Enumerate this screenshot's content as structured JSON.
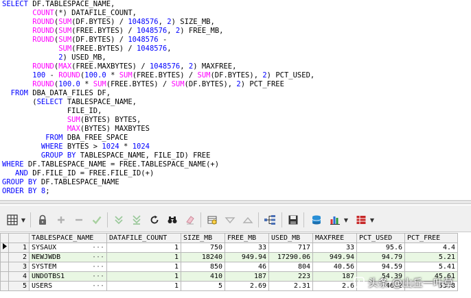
{
  "sql_editor": {
    "lines": [
      [
        [
          "kw",
          "SELECT"
        ],
        [
          "op",
          " DF.TABLESPACE_NAME,"
        ]
      ],
      [
        [
          "op",
          "       "
        ],
        [
          "fn",
          "COUNT"
        ],
        [
          "op",
          "(*) DATAFILE_COUNT,"
        ]
      ],
      [
        [
          "op",
          "       "
        ],
        [
          "fn",
          "ROUND"
        ],
        [
          "op",
          "("
        ],
        [
          "fn",
          "SUM"
        ],
        [
          "op",
          "(DF.BYTES) / "
        ],
        [
          "num",
          "1048576"
        ],
        [
          "op",
          ", "
        ],
        [
          "num",
          "2"
        ],
        [
          "op",
          ") SIZE_MB,"
        ]
      ],
      [
        [
          "op",
          "       "
        ],
        [
          "fn",
          "ROUND"
        ],
        [
          "op",
          "("
        ],
        [
          "fn",
          "SUM"
        ],
        [
          "op",
          "(FREE.BYTES) / "
        ],
        [
          "num",
          "1048576"
        ],
        [
          "op",
          ", "
        ],
        [
          "num",
          "2"
        ],
        [
          "op",
          ") FREE_MB,"
        ]
      ],
      [
        [
          "op",
          "       "
        ],
        [
          "fn",
          "ROUND"
        ],
        [
          "op",
          "("
        ],
        [
          "fn",
          "SUM"
        ],
        [
          "op",
          "(DF.BYTES) / "
        ],
        [
          "num",
          "1048576"
        ],
        [
          "op",
          " -"
        ]
      ],
      [
        [
          "op",
          "             "
        ],
        [
          "fn",
          "SUM"
        ],
        [
          "op",
          "(FREE.BYTES) / "
        ],
        [
          "num",
          "1048576"
        ],
        [
          "op",
          ","
        ]
      ],
      [
        [
          "op",
          "             "
        ],
        [
          "num",
          "2"
        ],
        [
          "op",
          ") USED_MB,"
        ]
      ],
      [
        [
          "op",
          "       "
        ],
        [
          "fn",
          "ROUND"
        ],
        [
          "op",
          "("
        ],
        [
          "fn",
          "MAX"
        ],
        [
          "op",
          "(FREE.MAXBYTES) / "
        ],
        [
          "num",
          "1048576"
        ],
        [
          "op",
          ", "
        ],
        [
          "num",
          "2"
        ],
        [
          "op",
          ") MAXFREE,"
        ]
      ],
      [
        [
          "op",
          "       "
        ],
        [
          "num",
          "100"
        ],
        [
          "op",
          " - "
        ],
        [
          "fn",
          "ROUND"
        ],
        [
          "op",
          "("
        ],
        [
          "num",
          "100.0"
        ],
        [
          "op",
          " * "
        ],
        [
          "fn",
          "SUM"
        ],
        [
          "op",
          "(FREE.BYTES) / "
        ],
        [
          "fn",
          "SUM"
        ],
        [
          "op",
          "(DF.BYTES), "
        ],
        [
          "num",
          "2"
        ],
        [
          "op",
          ") PCT_USED,"
        ]
      ],
      [
        [
          "op",
          "       "
        ],
        [
          "fn",
          "ROUND"
        ],
        [
          "op",
          "("
        ],
        [
          "num",
          "100.0"
        ],
        [
          "op",
          " * "
        ],
        [
          "fn",
          "SUM"
        ],
        [
          "op",
          "(FREE.BYTES) / "
        ],
        [
          "fn",
          "SUM"
        ],
        [
          "op",
          "(DF.BYTES), "
        ],
        [
          "num",
          "2"
        ],
        [
          "op",
          ") PCT_FREE"
        ]
      ],
      [
        [
          "op",
          "  "
        ],
        [
          "kw",
          "FROM"
        ],
        [
          "op",
          " DBA_DATA_FILES DF,"
        ]
      ],
      [
        [
          "op",
          "       ("
        ],
        [
          "kw",
          "SELECT"
        ],
        [
          "op",
          " TABLESPACE_NAME,"
        ]
      ],
      [
        [
          "op",
          "               FILE_ID,"
        ]
      ],
      [
        [
          "op",
          "               "
        ],
        [
          "fn",
          "SUM"
        ],
        [
          "op",
          "(BYTES) BYTES,"
        ]
      ],
      [
        [
          "op",
          "               "
        ],
        [
          "fn",
          "MAX"
        ],
        [
          "op",
          "(BYTES) MAXBYTES"
        ]
      ],
      [
        [
          "op",
          "          "
        ],
        [
          "kw",
          "FROM"
        ],
        [
          "op",
          " DBA_FREE_SPACE"
        ]
      ],
      [
        [
          "op",
          "         "
        ],
        [
          "kw",
          "WHERE"
        ],
        [
          "op",
          " BYTES > "
        ],
        [
          "num",
          "1024"
        ],
        [
          "op",
          " * "
        ],
        [
          "num",
          "1024"
        ]
      ],
      [
        [
          "op",
          "         "
        ],
        [
          "kw",
          "GROUP BY"
        ],
        [
          "op",
          " TABLESPACE_NAME, FILE_ID) FREE"
        ]
      ],
      [
        [
          "kw",
          "WHERE"
        ],
        [
          "op",
          " DF.TABLESPACE_NAME = FREE.TABLESPACE_NAME(+)"
        ]
      ],
      [
        [
          "op",
          "   "
        ],
        [
          "kw",
          "AND"
        ],
        [
          "op",
          " DF.FILE_ID = FREE.FILE_ID(+)"
        ]
      ],
      [
        [
          "kw",
          "GROUP BY"
        ],
        [
          "op",
          " DF.TABLESPACE_NAME"
        ]
      ],
      [
        [
          "kw",
          "ORDER BY"
        ],
        [
          "op",
          " "
        ],
        [
          "num",
          "8"
        ],
        [
          "op",
          ";"
        ]
      ]
    ]
  },
  "toolbar": {
    "icons": [
      "grid-layout-icon",
      "lock-icon",
      "add-record-icon",
      "delete-record-icon",
      "post-changes-icon",
      "fetch-next-icon",
      "fetch-last-icon",
      "refresh-icon",
      "find-icon",
      "clear-icon",
      "query-by-example-icon",
      "filter-down-icon",
      "filter-up-icon",
      "tree-view-icon",
      "save-icon",
      "export-database-icon",
      "chart-icon",
      "export-table-icon"
    ]
  },
  "results": {
    "columns": [
      "TABLESPACE_NAME",
      "DATAFILE_COUNT",
      "SIZE_MB",
      "FREE_MB",
      "USED_MB",
      "MAXFREE",
      "PCT_USED",
      "PCT_FREE"
    ],
    "rows": [
      {
        "n": "1",
        "tablespace": "SYSAUX",
        "count": "1",
        "size": "750",
        "free": "33",
        "used": "717",
        "maxfree": "33",
        "pct_used": "95.6",
        "pct_free": "4.4"
      },
      {
        "n": "2",
        "tablespace": "NEWJWDB",
        "count": "1",
        "size": "18240",
        "free": "949.94",
        "used": "17290.06",
        "maxfree": "949.94",
        "pct_used": "94.79",
        "pct_free": "5.21"
      },
      {
        "n": "3",
        "tablespace": "SYSTEM",
        "count": "1",
        "size": "850",
        "free": "46",
        "used": "804",
        "maxfree": "40.56",
        "pct_used": "94.59",
        "pct_free": "5.41"
      },
      {
        "n": "4",
        "tablespace": "UNDOTBS1",
        "count": "1",
        "size": "410",
        "free": "187",
        "used": "223",
        "maxfree": "187",
        "pct_used": "54.39",
        "pct_free": "45.61"
      },
      {
        "n": "5",
        "tablespace": "USERS",
        "count": "1",
        "size": "5",
        "free": "2.69",
        "used": "2.31",
        "maxfree": "2.6",
        "pct_used": "46.2",
        "pct_free": "53.8"
      }
    ],
    "ellipsis": "···"
  },
  "watermark": {
    "text": "头条 @山丘一叶草"
  }
}
